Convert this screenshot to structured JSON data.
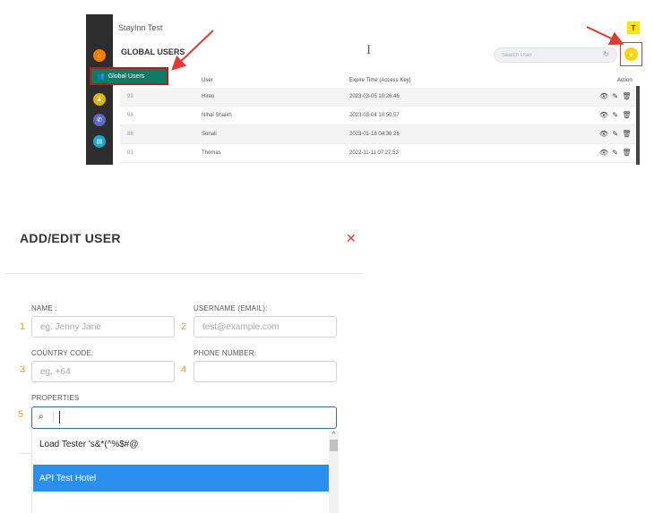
{
  "top_app": {
    "title": "StayInn Test",
    "avatar_initial": "T",
    "page_title": "GLOBAL USERS",
    "search_placeholder": "Search User",
    "highlight_item_label": "Global Users",
    "columns": [
      "User",
      "Expire Time (Access Key)",
      "Action"
    ],
    "rows": [
      {
        "id": "99",
        "user": "Hiren",
        "expire": "2023-03-05 10:26:46"
      },
      {
        "id": "98",
        "user": "Nihal Shaikh",
        "expire": "2023-03-04 10:50:57"
      },
      {
        "id": "88",
        "user": "Sonali",
        "expire": "2023-01-18 04:36:26"
      },
      {
        "id": "83",
        "user": "Thomas",
        "expire": "2022-11-11 07:27:53"
      }
    ],
    "sidebar_icons": [
      {
        "name": "home-icon",
        "color": "#f57c00"
      },
      {
        "name": "users-icon",
        "color": "#e0b400"
      },
      {
        "name": "phone-icon",
        "color": "#5c6bc0"
      },
      {
        "name": "document-icon",
        "color": "#1ca7c9"
      }
    ],
    "accent_red": "#e53935",
    "accent_teal": "#117a65"
  },
  "dialog": {
    "title": "ADD/EDIT USER",
    "fields": {
      "name": {
        "label": "NAME :",
        "placeholder": "eg. Jenny Jane",
        "step": "1"
      },
      "username": {
        "label": "USERNAME (EMAIL):",
        "placeholder": "test@example.com",
        "step": "2"
      },
      "country_code": {
        "label": "COUNTRY CODE:",
        "placeholder": "eg. +64",
        "step": "3"
      },
      "phone": {
        "label": "PHONE NUMBER:",
        "placeholder": "",
        "step": "4"
      },
      "properties": {
        "label": "PROPERTIES",
        "step": "5"
      }
    },
    "dropdown_options": [
      {
        "label": "Load Tester 's&*(^%$#@",
        "selected": false
      },
      {
        "label": "API Test Hotel",
        "selected": true
      }
    ],
    "selected_color": "#2b8ff0",
    "step_color": "#f0a01a"
  }
}
